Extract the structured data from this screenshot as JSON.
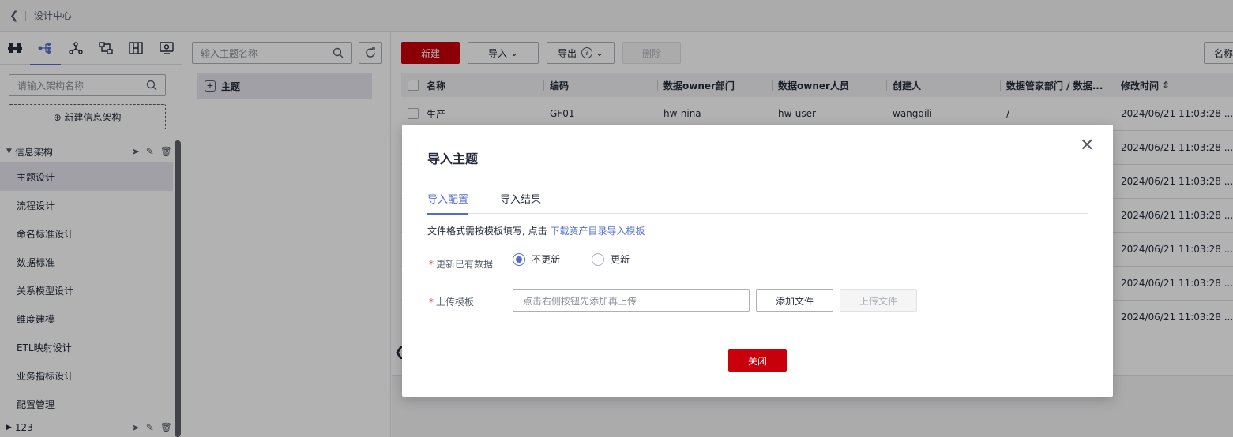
{
  "topbar": {
    "back_icon": "chevron-left-icon",
    "title": "设计中心"
  },
  "sidebar": {
    "icon_tabs": [
      "bridge-icon",
      "tree-icon",
      "hierarchy-icon",
      "flow-icon",
      "model-icon",
      "metric-icon"
    ],
    "search_placeholder": "请输入架构名称",
    "new_button": "⊕ 新建信息架构",
    "tree_root": "信息架构",
    "items": [
      "主题设计",
      "流程设计",
      "命名标准设计",
      "数据标准",
      "关系模型设计",
      "维度建模",
      "ETL映射设计",
      "业务指标设计",
      "配置管理"
    ],
    "active_item": "主题设计",
    "tree_root2": "123"
  },
  "theme_panel": {
    "search_placeholder": "输入主题名称",
    "root_node": "主题"
  },
  "toolbar": {
    "new": "新建",
    "import": "导入",
    "export": "导出",
    "delete": "删除",
    "name_button": "名称"
  },
  "table": {
    "columns": [
      "名称",
      "编码",
      "数据owner部门",
      "数据owner人员",
      "创建人",
      "数据管家部门 / 数据...",
      "修改时间"
    ],
    "rows": [
      {
        "name": "生产",
        "code": "GF01",
        "dept": "hw-nina",
        "owner": "hw-user",
        "creator": "wangqili",
        "steward": "/",
        "mtime": "2024/06/21 11:03:28 ..."
      },
      {
        "mtime": "2024/06/21 11:03:28 ..."
      },
      {
        "mtime": "2024/06/21 11:03:28 ..."
      },
      {
        "mtime": "2024/06/21 11:03:28 ..."
      },
      {
        "mtime": "2024/06/21 11:03:28 ..."
      },
      {
        "mtime": "2024/06/21 11:03:28 ..."
      },
      {
        "mtime": "2024/06/21 11:03:28 ..."
      }
    ]
  },
  "modal": {
    "title": "导入主题",
    "tabs": [
      "导入配置",
      "导入结果"
    ],
    "active_tab": "导入配置",
    "hint_prefix": "文件格式需按模板填写, 点击 ",
    "hint_link": "下载资产目录导入模板",
    "field_update": {
      "label": "更新已有数据",
      "options": [
        "不更新",
        "更新"
      ],
      "selected": "不更新"
    },
    "field_upload": {
      "label": "上传模板",
      "placeholder": "点击右侧按钮先添加再上传",
      "add_button": "添加文件",
      "upload_button": "上传文件"
    },
    "close_button": "关闭",
    "required_mark": "*"
  }
}
